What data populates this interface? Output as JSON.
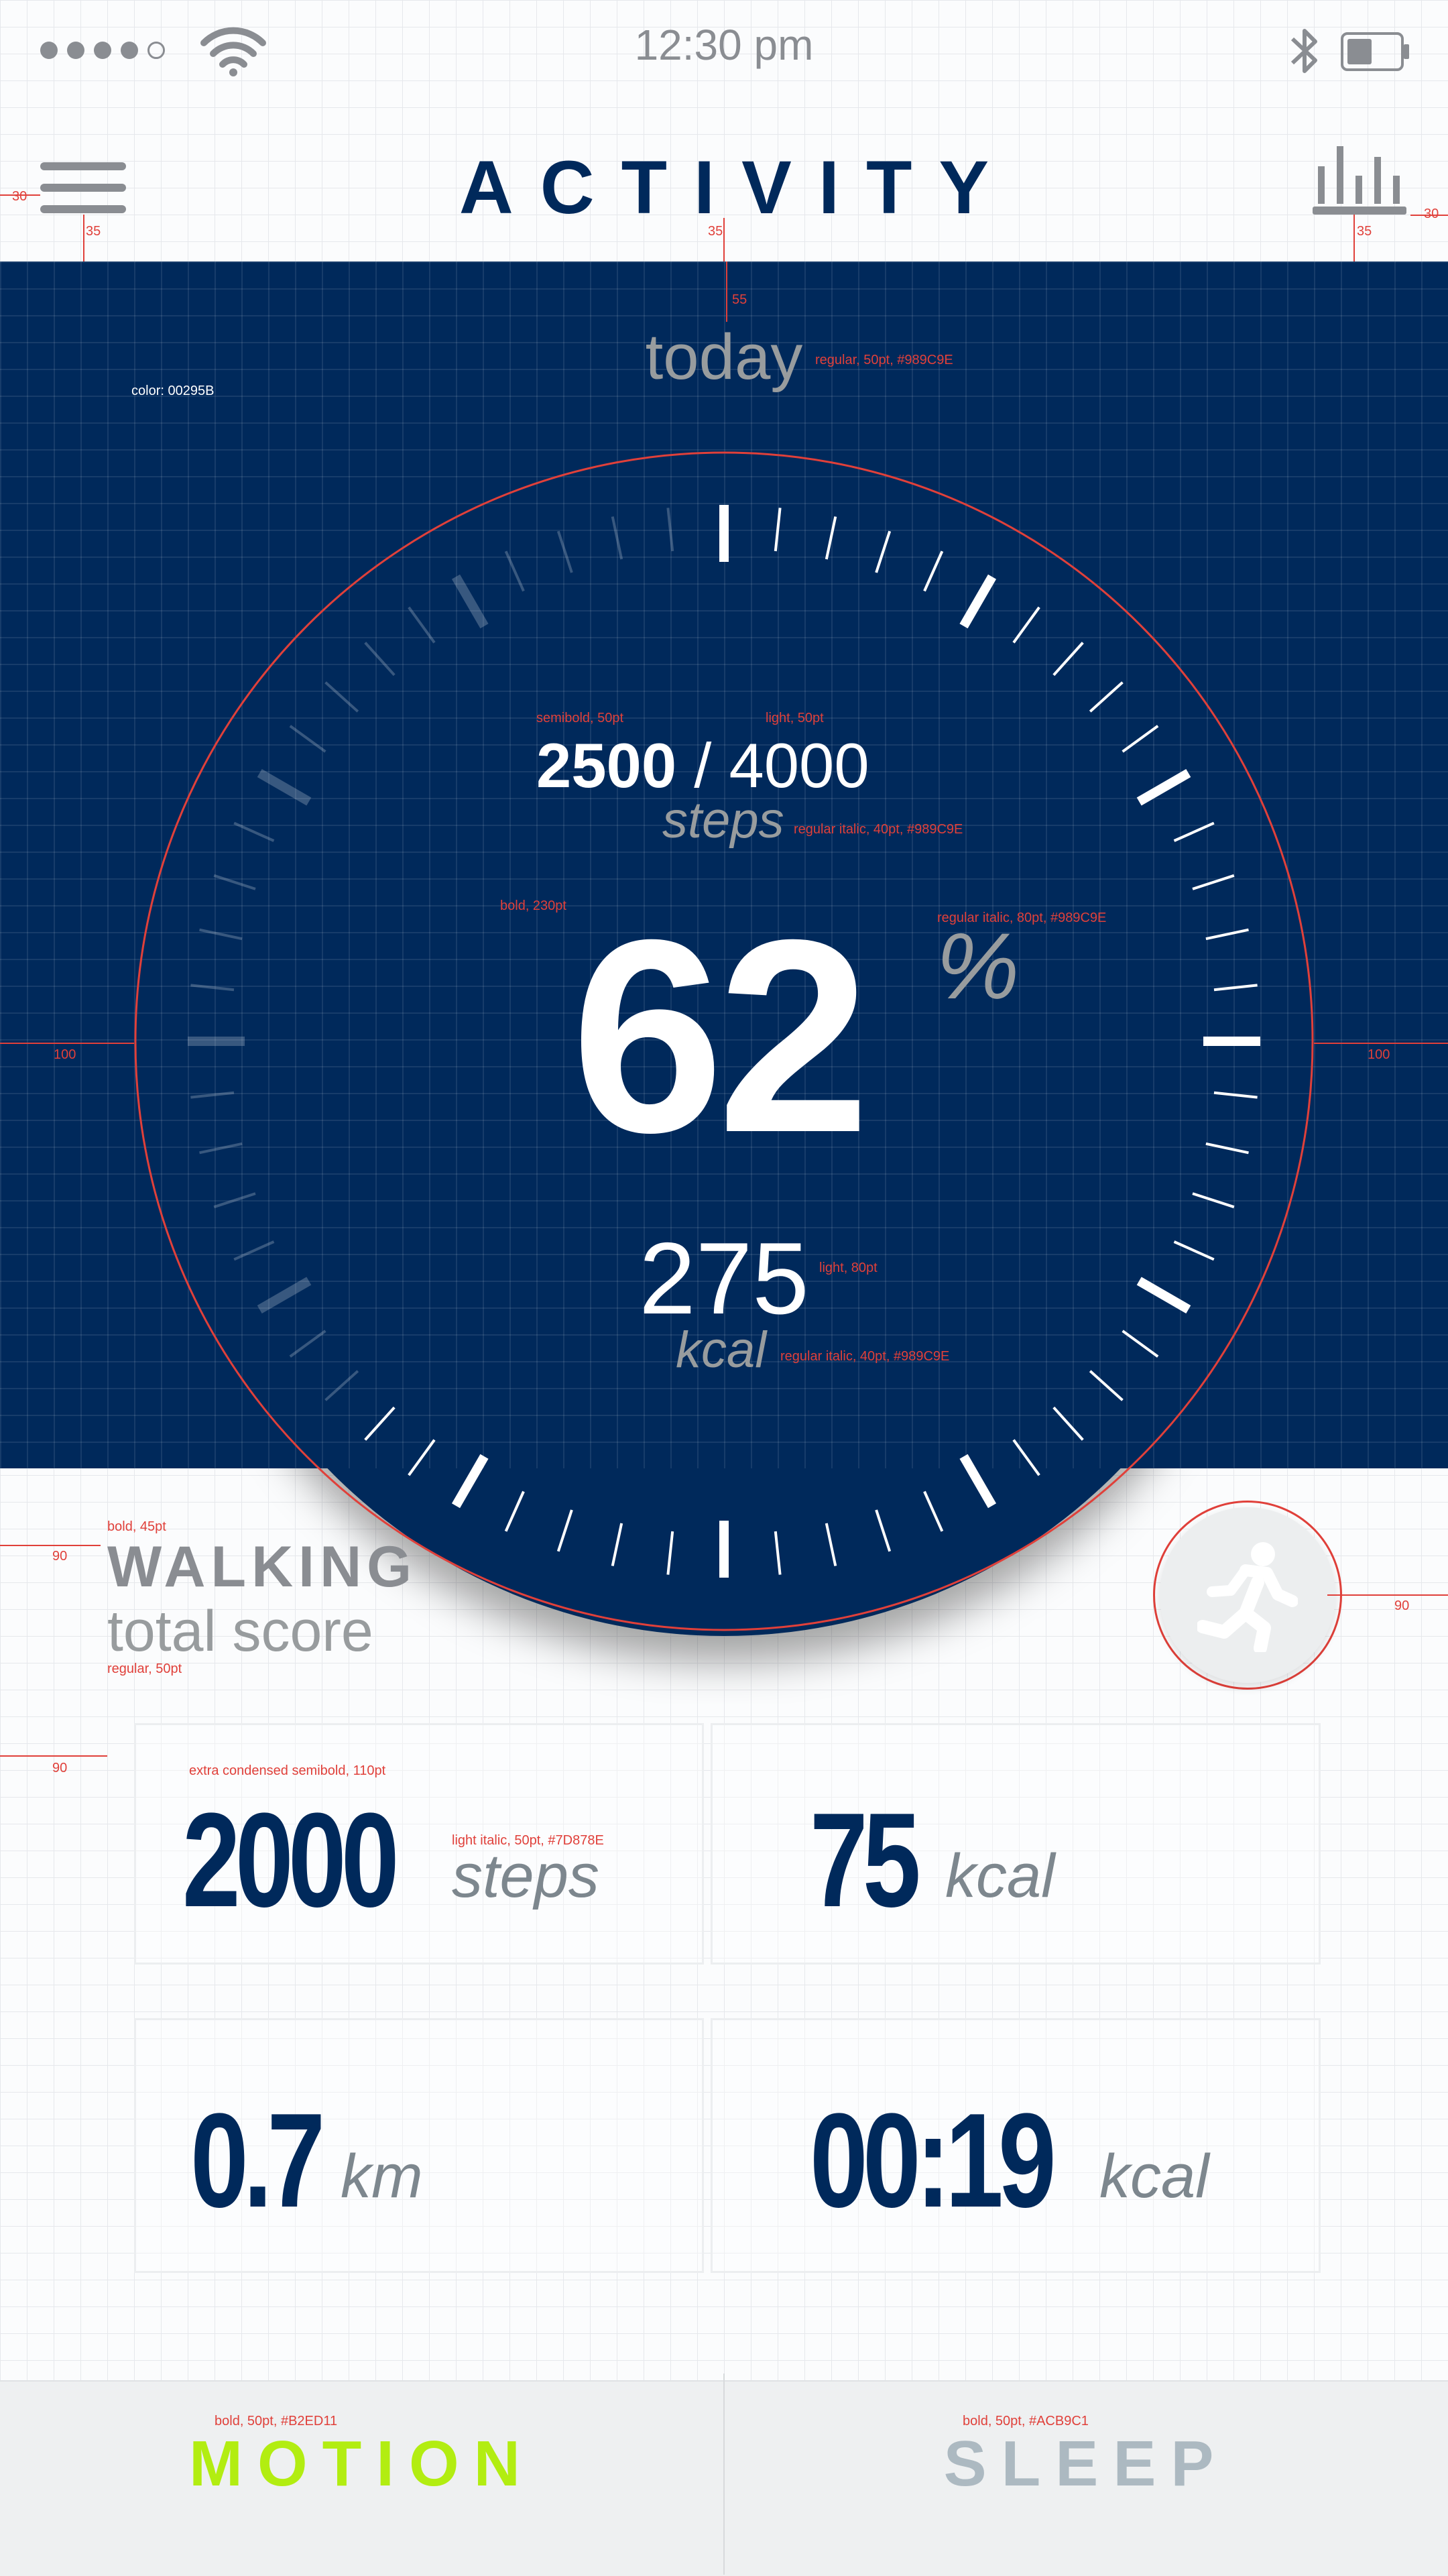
{
  "status_bar": {
    "time": "12:30 pm",
    "signal_bars": 4,
    "signal_total": 5
  },
  "header": {
    "title": "ACTIVITY"
  },
  "today": {
    "label": "today"
  },
  "progress": {
    "steps_current": "2500",
    "steps_sep": "/ 4000",
    "steps_unit": "steps",
    "percent_value": "62",
    "percent_sign": "%",
    "percent_fraction": 0.62,
    "kcal_value": "275",
    "kcal_unit": "kcal"
  },
  "walking": {
    "title": "WALKING",
    "subtitle": "total score"
  },
  "stats": [
    {
      "value": "2000",
      "unit": "steps"
    },
    {
      "value": "75",
      "unit": "kcal"
    },
    {
      "value": "0.7",
      "unit": "km"
    },
    {
      "value": "00:19",
      "unit": "kcal"
    }
  ],
  "tabs": [
    {
      "label": "MOTION",
      "color": "#B2ED11"
    },
    {
      "label": "SLEEP",
      "color": "#ACB9C1"
    }
  ],
  "annotations": {
    "color_note": "color: 00295B",
    "today_spec": "regular, 50pt, #989C9E",
    "steps_current_spec": "semibold, 50pt",
    "steps_total_spec": "light, 50pt",
    "steps_unit_spec": "regular italic, 40pt, #989C9E",
    "percent_spec": "bold, 230pt",
    "percent_sign_spec": "regular italic, 80pt, #989C9E",
    "kcal_spec": "light, 80pt",
    "kcal_unit_spec": "regular italic, 40pt, #989C9E",
    "walking_spec": "bold, 45pt",
    "total_score_spec": "regular, 50pt",
    "stats_num_spec": "extra condensed semibold, 110pt",
    "stats_unit_spec": "light italic, 50pt, #7D878E",
    "motion_spec": "bold, 50pt, #B2ED11",
    "sleep_spec": "bold, 50pt, #ACB9C1",
    "m30": "30",
    "m35": "35",
    "m55": "55",
    "m100": "100",
    "m90": "90"
  },
  "colors": {
    "brand_blue": "#00295B",
    "label_grey": "#989C9E",
    "unit_grey": "#7D878E",
    "ruler_red": "#E0403A"
  }
}
